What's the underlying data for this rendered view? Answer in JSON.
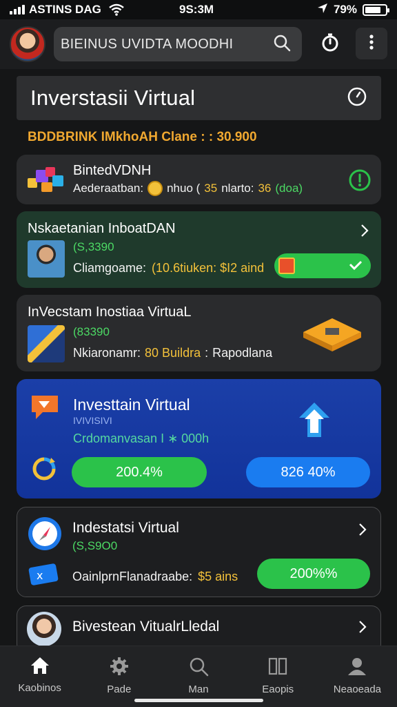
{
  "status_bar": {
    "carrier": "ASTINS DAG",
    "time": "9S:3M",
    "battery": "79%",
    "battery_level": 0.79
  },
  "search": {
    "text": "BIEINUS UVIDTA MOODHI"
  },
  "header": {
    "title": "Inverstasii Virtual"
  },
  "balance": {
    "text": "BDDBRINK IMkhoAH Clane : : 30.900"
  },
  "cards": [
    {
      "name": "BintedVDNH",
      "detail_label": "Aederaatban:",
      "detail_mid": "nhuo (",
      "detail_value1": "35",
      "detail_label2": "nlarto:",
      "detail_value2": "36",
      "detail_suffix": "(doa)"
    },
    {
      "name": "Nskaetanian InboatDAN",
      "sub": "(S,3390",
      "detail_label": "Cliamgoame:",
      "detail_value": "(10.6tiuken: $I2 aind"
    },
    {
      "name": "InVecstam Inostiaa VirtuaL",
      "sub": "(83390",
      "detail_label": "Nkiaronamr:",
      "detail_value": "80 Buildra",
      "detail_sep": ":",
      "detail_suffix": "Rapodlana"
    },
    {
      "name": "Investtain Virtual",
      "sub1": "IVIVISIVI",
      "sub2": "Crdomanvasan I ∗ 000h",
      "pill_left": "200.4%",
      "pill_right": "826 40%"
    },
    {
      "name": "Indestatsi Virtual",
      "sub": "(S,S9O0",
      "detail_label": "OainlprnFlanadraabe:",
      "detail_value": "$5 ains",
      "pill": "200%%"
    },
    {
      "name": "Bivestean VitualrLledal"
    }
  ],
  "nav": [
    {
      "label": "Kaobinos",
      "icon": "home-icon"
    },
    {
      "label": "Pade",
      "icon": "gear-icon"
    },
    {
      "label": "Man",
      "icon": "search-icon"
    },
    {
      "label": "Eaopis",
      "icon": "panels-icon"
    },
    {
      "label": "Neaoeada",
      "icon": "user-icon"
    }
  ],
  "colors": {
    "accent_green": "#2bc24a",
    "accent_blue": "#1a7cf0",
    "gold": "#f3c13a",
    "card_blue": "#1b3fa8"
  }
}
